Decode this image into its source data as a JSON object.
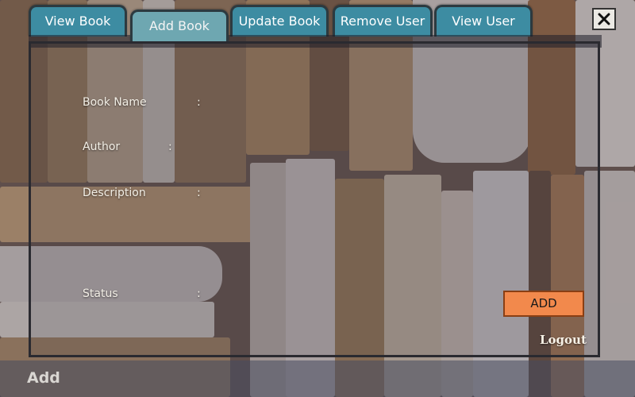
{
  "tabs": [
    {
      "label": "View Book"
    },
    {
      "label": "Add Book"
    },
    {
      "label": "Update Book"
    },
    {
      "label": "Remove User"
    },
    {
      "label": "View User"
    }
  ],
  "active_tab": "Add Book",
  "form": {
    "book_name_label": "Book Name",
    "author_label": "Author",
    "description_label": "Description",
    "status_label": "Status",
    "colon": ":"
  },
  "actions": {
    "add_label": "ADD",
    "logout_label": "Logout"
  },
  "window": {
    "close_icon": "close-icon"
  },
  "status_bar": {
    "label": "Add"
  },
  "colors": {
    "tab_inactive": "#3d8ca2",
    "tab_active": "#6ea7b1",
    "add_button": "#f2894c"
  }
}
